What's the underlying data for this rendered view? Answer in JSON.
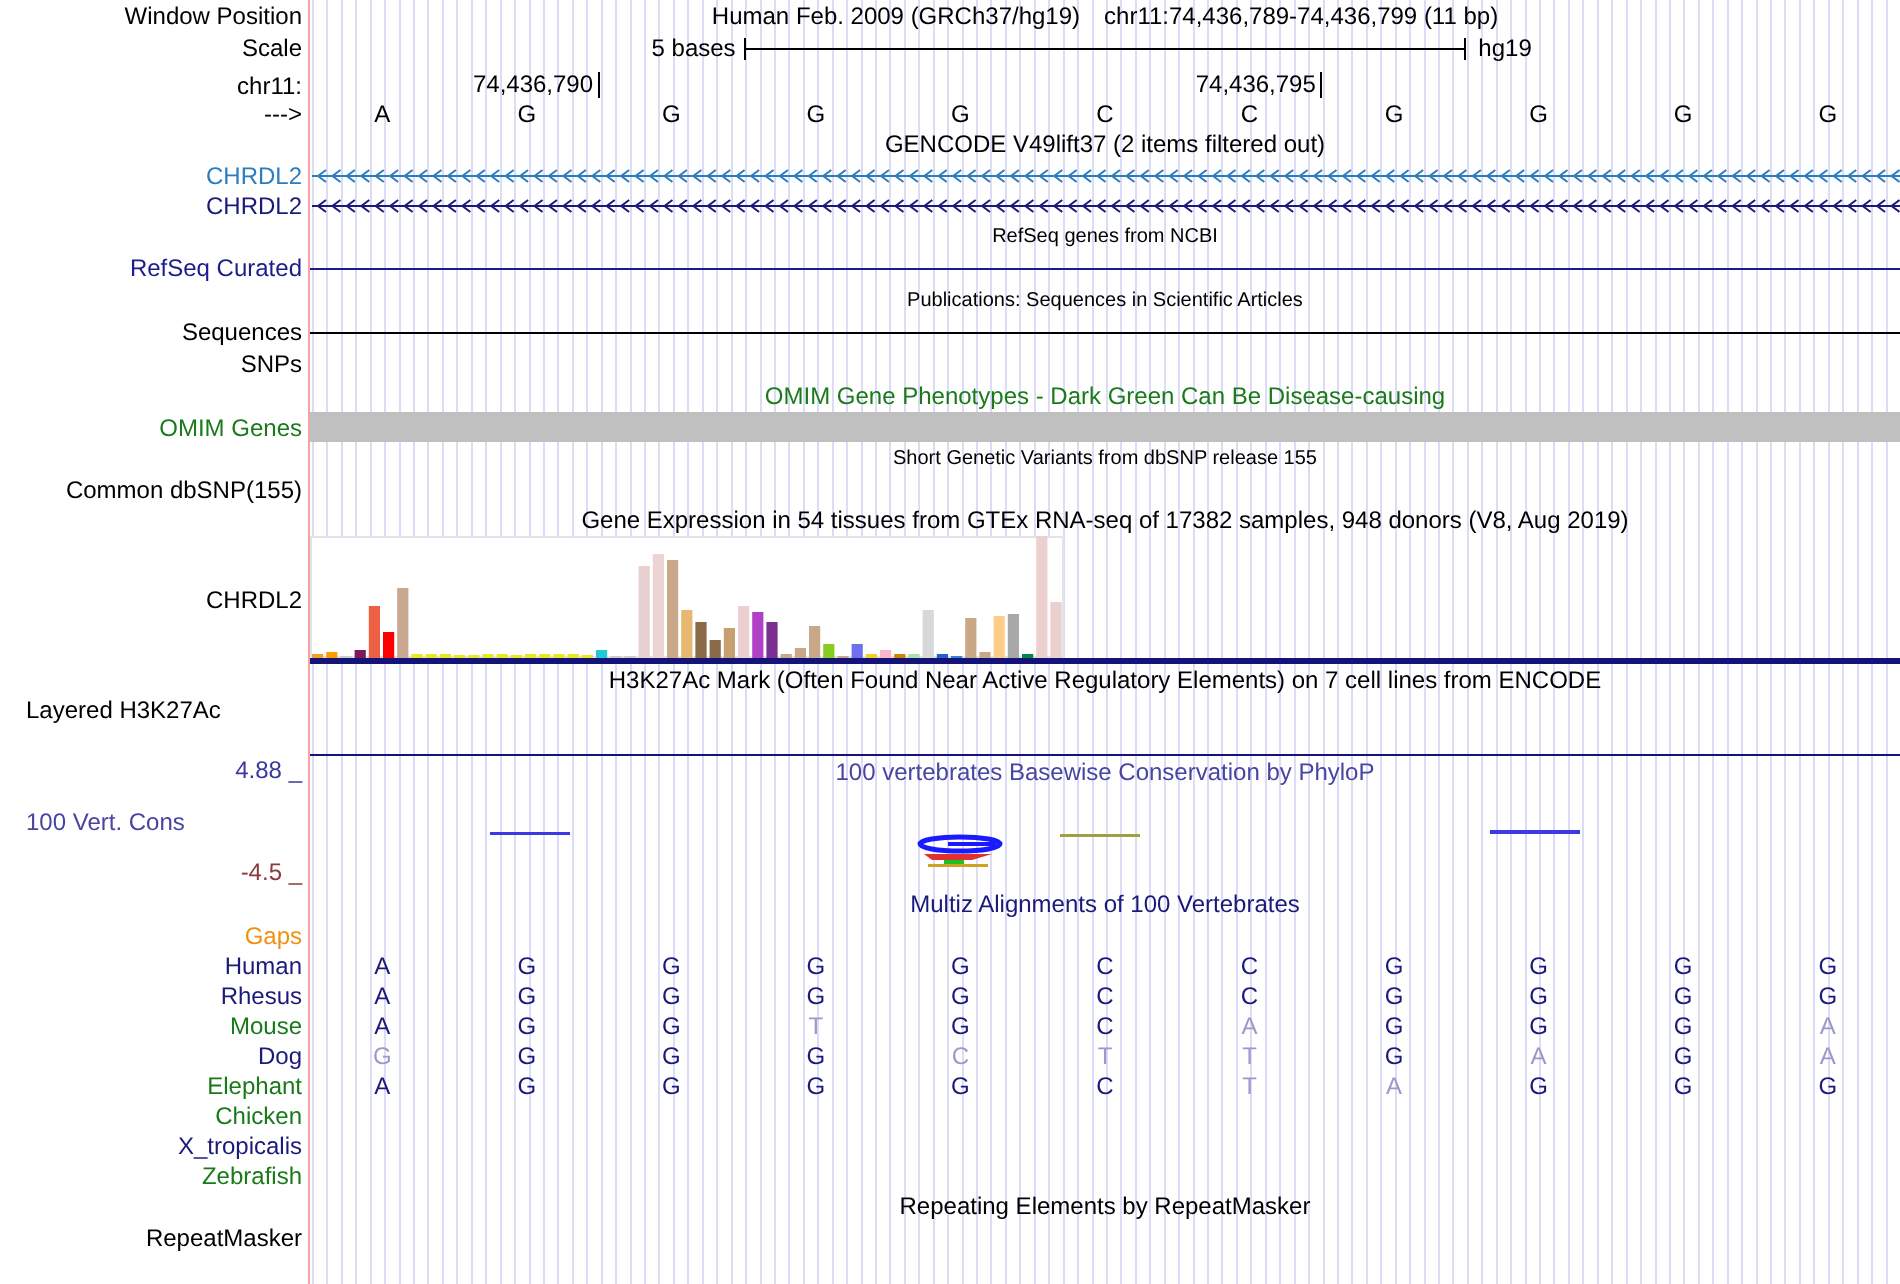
{
  "ruler": {
    "position_label": "Window Position",
    "assembly": "Human Feb. 2009 (GRCh37/hg19)",
    "range": "chr11:74,436,789-74,436,799 (11 bp)",
    "scale_label": "Scale",
    "scale_text": "5 bases",
    "scale_db": "hg19",
    "chrom_label": "chr11:",
    "ticks": [
      "74,436,790",
      "74,436,795"
    ],
    "strand_label": "--->",
    "bases": [
      "A",
      "G",
      "G",
      "G",
      "G",
      "C",
      "C",
      "G",
      "G",
      "G",
      "G"
    ]
  },
  "tracks": [
    {
      "kind": "genes",
      "title": {
        "text": "GENCODE V49lift37 (2 items filtered out)",
        "color": "#000000"
      },
      "genes": [
        {
          "name": "CHRDL2",
          "color": "#2a7dbf"
        },
        {
          "name": "CHRDL2",
          "color": "#1a1a7a"
        }
      ]
    },
    {
      "kind": "line",
      "title": {
        "text": "RefSeq genes from NCBI",
        "color": "#000000"
      },
      "label": {
        "text": "RefSeq Curated",
        "color": "#1c1c8c"
      }
    },
    {
      "kind": "line",
      "title": {
        "text": "Publications: Sequences in Scientific Articles",
        "color": "#000000"
      },
      "label": {
        "text": "Sequences",
        "color": "#000000"
      }
    },
    {
      "kind": "blank",
      "label": {
        "text": "SNPs",
        "color": "#000000"
      }
    },
    {
      "kind": "bar",
      "title": {
        "text": "OMIM Gene Phenotypes - Dark Green Can Be Disease-causing",
        "color": "#1a7a1a"
      },
      "label": {
        "text": "OMIM Genes",
        "color": "#1a7a1a"
      }
    },
    {
      "kind": "blank",
      "title": {
        "text": "Short Genetic Variants from dbSNP release 155",
        "color": "#000000"
      },
      "label": {
        "text": "Common dbSNP(155)",
        "color": "#000000"
      }
    },
    {
      "kind": "expression",
      "title": {
        "text": "Gene Expression in 54 tissues from GTEx RNA-seq of 17382 samples, 948 donors (V8, Aug 2019)",
        "color": "#000000"
      },
      "label": {
        "text": "CHRDL2",
        "color": "#000000"
      }
    },
    {
      "kind": "density",
      "title": {
        "text": "H3K27Ac Mark (Often Found Near Active Regulatory Elements) on 7 cell lines from ENCODE",
        "color": "#000000"
      },
      "label": {
        "text": "Layered H3K27Ac",
        "color": "#000000"
      }
    },
    {
      "kind": "conservation",
      "title": {
        "text": "100 vertebrates Basewise Conservation by PhyloP",
        "color": "#4646a0"
      },
      "label": {
        "text": "100 Vert. Cons",
        "color": "#4646a0"
      },
      "max": {
        "text": "4.88 _",
        "color": "#3a3a9a"
      },
      "min": {
        "text": "-4.5 _",
        "color": "#8b3a3a"
      }
    },
    {
      "kind": "alignment",
      "title": {
        "text": "Multiz Alignments of 100 Vertebrates",
        "color": "#1a1a7a"
      },
      "gaps": {
        "text": "Gaps",
        "color": "#f09010"
      },
      "species": [
        {
          "name": "Human",
          "color": "#1a1a7a",
          "bases": [
            {
              "base": "A",
              "mismatch": false
            },
            {
              "base": "G",
              "mismatch": false
            },
            {
              "base": "G",
              "mismatch": false
            },
            {
              "base": "G",
              "mismatch": false
            },
            {
              "base": "G",
              "mismatch": false
            },
            {
              "base": "C",
              "mismatch": false
            },
            {
              "base": "C",
              "mismatch": false
            },
            {
              "base": "G",
              "mismatch": false
            },
            {
              "base": "G",
              "mismatch": false
            },
            {
              "base": "G",
              "mismatch": false
            },
            {
              "base": "G",
              "mismatch": false
            }
          ]
        },
        {
          "name": "Rhesus",
          "color": "#1a1a7a",
          "bases": [
            {
              "base": "A",
              "mismatch": false
            },
            {
              "base": "G",
              "mismatch": false
            },
            {
              "base": "G",
              "mismatch": false
            },
            {
              "base": "G",
              "mismatch": false
            },
            {
              "base": "G",
              "mismatch": false
            },
            {
              "base": "C",
              "mismatch": false
            },
            {
              "base": "C",
              "mismatch": false
            },
            {
              "base": "G",
              "mismatch": false
            },
            {
              "base": "G",
              "mismatch": false
            },
            {
              "base": "G",
              "mismatch": false
            },
            {
              "base": "G",
              "mismatch": false
            }
          ]
        },
        {
          "name": "Mouse",
          "color": "#1a7a1a",
          "bases": [
            {
              "base": "A",
              "mismatch": false
            },
            {
              "base": "G",
              "mismatch": false
            },
            {
              "base": "G",
              "mismatch": false
            },
            {
              "base": "T",
              "mismatch": true
            },
            {
              "base": "G",
              "mismatch": false
            },
            {
              "base": "C",
              "mismatch": false
            },
            {
              "base": "A",
              "mismatch": true
            },
            {
              "base": "G",
              "mismatch": false
            },
            {
              "base": "G",
              "mismatch": false
            },
            {
              "base": "G",
              "mismatch": false
            },
            {
              "base": "A",
              "mismatch": true
            }
          ]
        },
        {
          "name": "Dog",
          "color": "#1a1a7a",
          "bases": [
            {
              "base": "G",
              "mismatch": true
            },
            {
              "base": "G",
              "mismatch": false
            },
            {
              "base": "G",
              "mismatch": false
            },
            {
              "base": "G",
              "mismatch": false
            },
            {
              "base": "C",
              "mismatch": true
            },
            {
              "base": "T",
              "mismatch": true
            },
            {
              "base": "T",
              "mismatch": true
            },
            {
              "base": "G",
              "mismatch": false
            },
            {
              "base": "A",
              "mismatch": true
            },
            {
              "base": "G",
              "mismatch": false
            },
            {
              "base": "A",
              "mismatch": true
            }
          ]
        },
        {
          "name": "Elephant",
          "color": "#1a7a1a",
          "bases": [
            {
              "base": "A",
              "mismatch": false
            },
            {
              "base": "G",
              "mismatch": false
            },
            {
              "base": "G",
              "mismatch": false
            },
            {
              "base": "G",
              "mismatch": false
            },
            {
              "base": "G",
              "mismatch": false
            },
            {
              "base": "C",
              "mismatch": false
            },
            {
              "base": "T",
              "mismatch": true
            },
            {
              "base": "A",
              "mismatch": true
            },
            {
              "base": "G",
              "mismatch": false
            },
            {
              "base": "G",
              "mismatch": false
            },
            {
              "base": "G",
              "mismatch": false
            }
          ]
        },
        {
          "name": "Chicken",
          "color": "#1a7a1a"
        },
        {
          "name": "X_tropicalis",
          "color": "#1a1a7a"
        },
        {
          "name": "Zebrafish",
          "color": "#1a7a1a"
        }
      ]
    },
    {
      "kind": "annotation",
      "title": {
        "text": "Repeating Elements by RepeatMasker",
        "color": "#000000"
      },
      "label": {
        "text": "RepeatMasker",
        "color": "#000000"
      }
    }
  ]
}
